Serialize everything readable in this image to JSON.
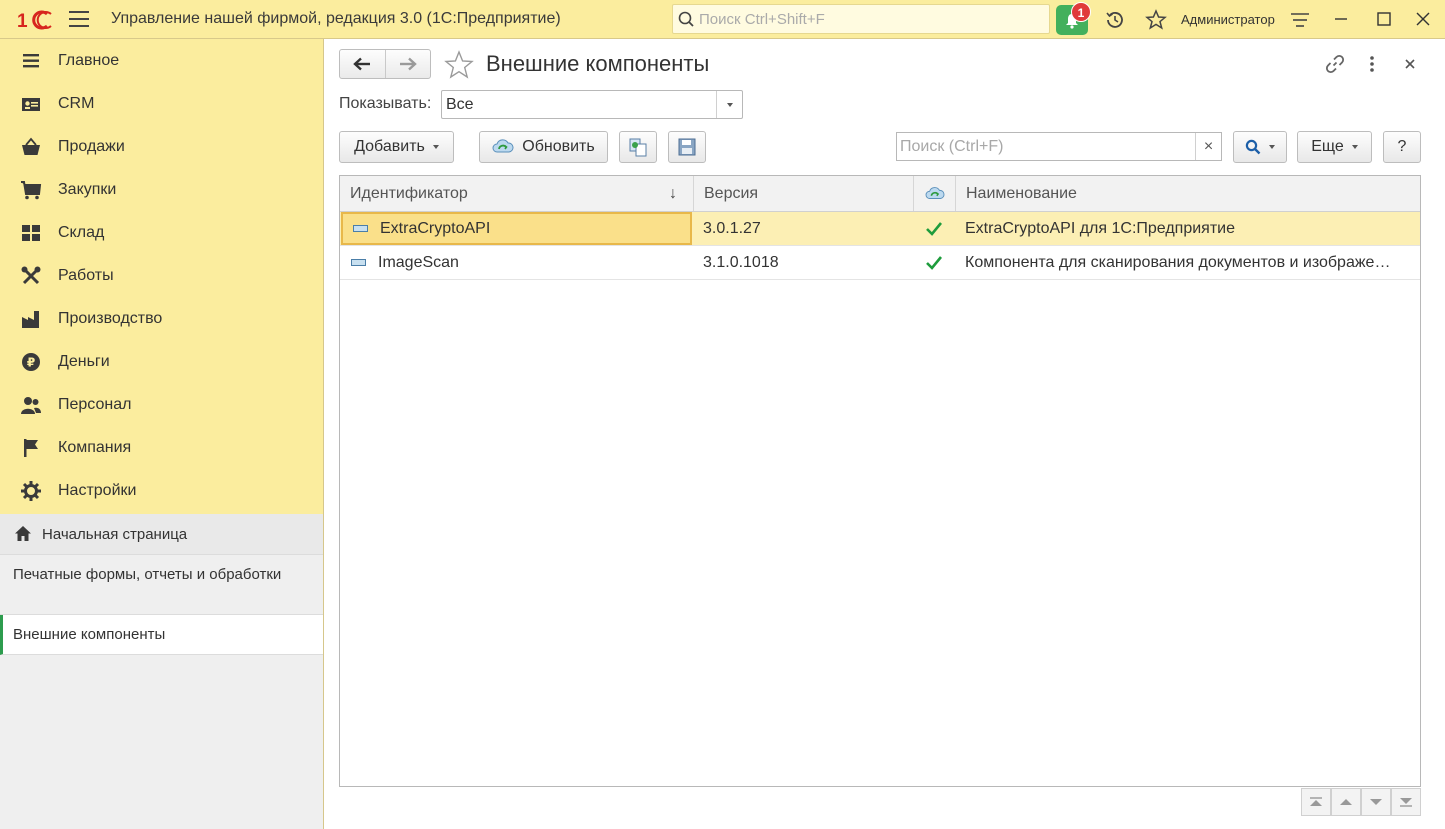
{
  "app": {
    "title": "Управление нашей фирмой, редакция 3.0  (1С:Предприятие)",
    "search_placeholder": "Поиск Ctrl+Shift+F",
    "notification_count": "1",
    "user": "Администратор",
    "brand_color": "#d7261e",
    "accent_color": "#fbed9e"
  },
  "sidebar": {
    "items": [
      {
        "label": "Главное",
        "icon": "menu-lines-icon"
      },
      {
        "label": "CRM",
        "icon": "crm-card-icon"
      },
      {
        "label": "Продажи",
        "icon": "basket-icon"
      },
      {
        "label": "Закупки",
        "icon": "cart-icon"
      },
      {
        "label": "Склад",
        "icon": "warehouse-grid-icon"
      },
      {
        "label": "Работы",
        "icon": "tools-icon"
      },
      {
        "label": "Производство",
        "icon": "factory-icon"
      },
      {
        "label": "Деньги",
        "icon": "ruble-icon"
      },
      {
        "label": "Персонал",
        "icon": "people-icon"
      },
      {
        "label": "Компания",
        "icon": "flag-icon"
      },
      {
        "label": "Настройки",
        "icon": "gear-icon"
      }
    ],
    "open_windows": {
      "home": "Начальная страница",
      "print": "Печатные формы, отчеты и обработки",
      "active": "Внешние компоненты"
    }
  },
  "main": {
    "title": "Внешние компоненты",
    "show_label": "Показывать:",
    "show_value": "Все",
    "toolbar": {
      "add": "Добавить",
      "refresh": "Обновить",
      "search_placeholder": "Поиск (Ctrl+F)",
      "more": "Еще",
      "help": "?"
    },
    "table": {
      "columns": [
        "Идентификатор",
        "Версия",
        "",
        "Наименование"
      ],
      "sort_indicator": "↓",
      "rows": [
        {
          "id": "ExtraCryptoAPI",
          "version": "3.0.1.27",
          "checked": true,
          "name": "ExtraCryptoAPI для 1С:Предприятие"
        },
        {
          "id": "ImageScan",
          "version": "3.1.0.1018",
          "checked": true,
          "name": "Компонента для сканирования документов и изображе…"
        }
      ]
    }
  }
}
